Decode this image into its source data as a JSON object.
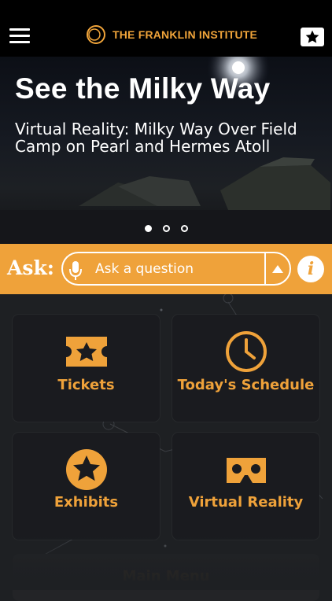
{
  "header": {
    "menu_icon": "hamburger-icon",
    "logo_text": "THE FRANKLIN INSTITUTE",
    "favorite_icon": "star-badge-icon"
  },
  "hero": {
    "title": "See the Milky Way",
    "subtitle": "Virtual Reality: Milky Way Over Field Camp on Pearl and Hermes Atoll",
    "carousel_pages": 3,
    "active_page": 1
  },
  "ask": {
    "label": "Ask:",
    "placeholder": "Ask a question",
    "mic_icon": "microphone-icon",
    "submit_icon": "triangle-up-icon",
    "info_icon": "info-icon",
    "info_glyph": "i"
  },
  "tiles": [
    {
      "label": "Tickets",
      "icon": "ticket-icon"
    },
    {
      "label": "Today's Schedule",
      "icon": "clock-icon"
    },
    {
      "label": "Exhibits",
      "icon": "star-circle-icon"
    },
    {
      "label": "Virtual Reality",
      "icon": "vr-headset-icon"
    }
  ],
  "main_menu": {
    "label": "Main Menu"
  },
  "colors": {
    "accent": "#efa23a",
    "background": "#1e2023",
    "header": "#000000"
  }
}
